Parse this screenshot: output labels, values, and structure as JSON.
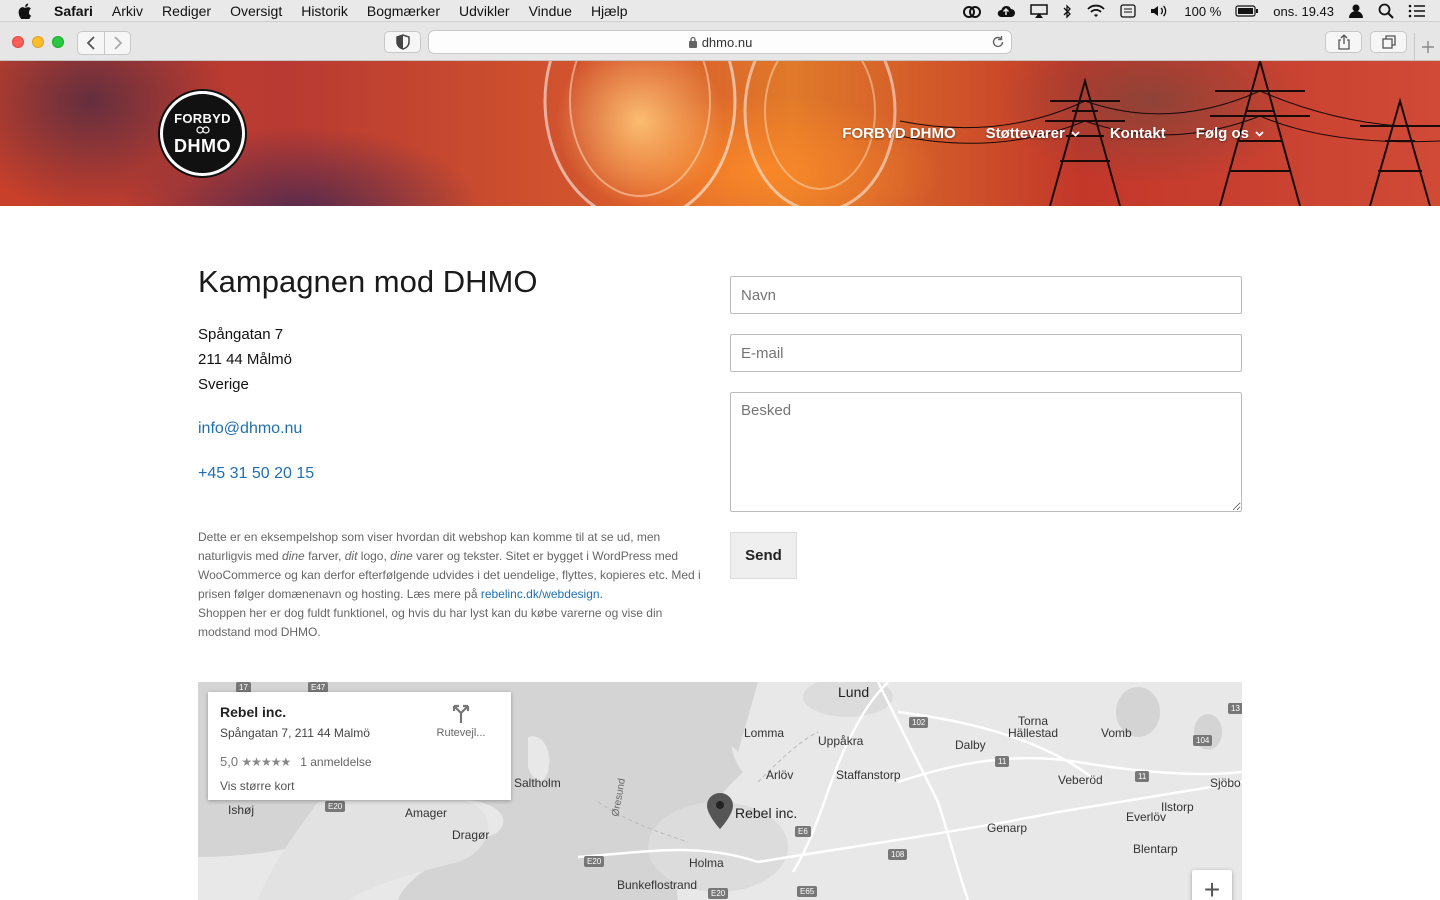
{
  "menubar": {
    "app": "Safari",
    "items": [
      "Arkiv",
      "Rediger",
      "Oversigt",
      "Historik",
      "Bogmærker",
      "Udvikler",
      "Vindue",
      "Hjælp"
    ],
    "battery": "100 %",
    "clock": "ons. 19.43"
  },
  "browser": {
    "url": "dhmo.nu"
  },
  "site": {
    "logo_line1": "FORBYD",
    "logo_line2": "DHMO",
    "nav": [
      {
        "label": "FORBYD DHMO",
        "dropdown": false
      },
      {
        "label": "Støttevarer",
        "dropdown": true
      },
      {
        "label": "Kontakt",
        "dropdown": false
      },
      {
        "label": "Følg os",
        "dropdown": true
      }
    ]
  },
  "contact": {
    "title": "Kampagnen mod DHMO",
    "address_lines": [
      "Spångatan 7",
      "211 44 Målmö",
      "Sverige"
    ],
    "email": "info@dhmo.nu",
    "phone": "+45 31 50 20 15",
    "desc": {
      "p1_a": "Dette er en eksempelshop som viser hvordan dit webshop kan komme til at se ud, men naturligvis med ",
      "em1": "dine",
      "p1_b": " farver, ",
      "em2": "dit",
      "p1_c": " logo, ",
      "em3": "dine",
      "p1_d": " varer og tekster. Sitet er bygget i WordPress med WooCommerce og kan derfor efterfølgende udvides i det uendelige, flyttes, kopieres etc. Med i prisen følger domænenavn og hosting. Læs mere på ",
      "link": "rebelinc.dk/webdesign",
      "p1_e": ".",
      "p2": "Shoppen her er dog fuldt funktionel, og hvis du har lyst kan du købe varerne og vise din modstand mod DHMO."
    }
  },
  "form": {
    "name_placeholder": "Navn",
    "email_placeholder": "E-mail",
    "message_placeholder": "Besked",
    "send_label": "Send"
  },
  "map": {
    "card_title": "Rebel inc.",
    "card_address": "Spångatan 7, 211 44 Malmö",
    "rating": "5,0",
    "stars": "★★★★★",
    "reviews": "1 anmeldelse",
    "bigger_map": "Vis større kort",
    "directions": "Rutevejl...",
    "pin_label": "Rebel inc.",
    "zoom_in": "+",
    "places": {
      "lund": "Lund",
      "lomma": "Lomma",
      "uppakra": "Uppåkra",
      "torna": "Torna Hällestad",
      "vomb": "Vomb",
      "dalby": "Dalby",
      "arlov": "Arlöv",
      "staffanstorp": "Staffanstorp",
      "veberod": "Veberöd",
      "sjobo": "Sjöbo",
      "ilstorp": "Ilstorp",
      "everlov": "Everlöv",
      "genarp": "Genarp",
      "blentarp": "Blentarp",
      "saltholm": "Saltholm",
      "amager": "Amager",
      "dragor": "Dragør",
      "ishoj": "Ishøj",
      "holma": "Holma",
      "bunkeflo": "Bunkeflostrand",
      "oresund": "Øresund"
    },
    "roads": {
      "r102": "102",
      "r104": "104",
      "r11a": "11",
      "r11b": "11",
      "r108": "108",
      "e6": "E6",
      "e20a": "E20",
      "e20b": "E20",
      "e20c": "E20",
      "e65": "E65",
      "r13": "13",
      "r17": "17",
      "e47": "E47"
    }
  }
}
